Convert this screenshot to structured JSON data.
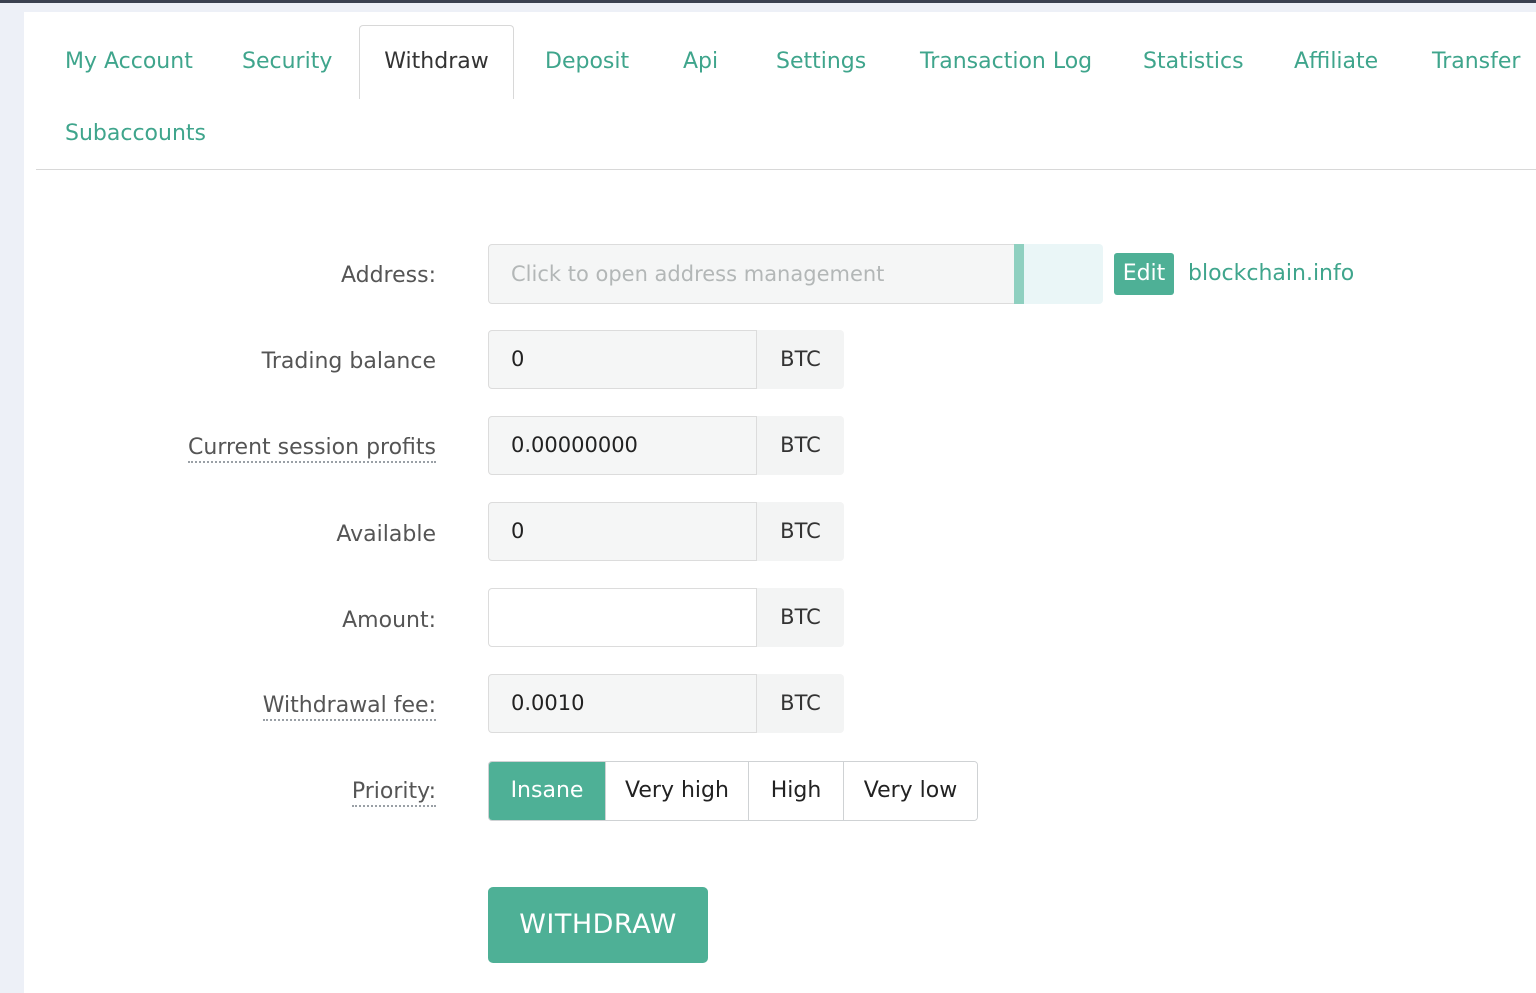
{
  "tabs": {
    "row1": [
      "My Account",
      "Security",
      "Withdraw",
      "Deposit",
      "Api",
      "Settings",
      "Transaction Log",
      "Statistics",
      "Affiliate",
      "Transfer"
    ],
    "row2": [
      "Subaccounts"
    ],
    "active": "Withdraw"
  },
  "form": {
    "address_label": "Address:",
    "address_placeholder": "Click to open address management",
    "edit_label": "Edit",
    "explorer_link": "blockchain.info",
    "trading_balance_label": "Trading balance",
    "trading_balance_value": "0",
    "session_profits_label": "Current session profits",
    "session_profits_value": "0.00000000",
    "available_label": "Available",
    "available_value": "0",
    "amount_label": "Amount:",
    "amount_value": "",
    "fee_label": "Withdrawal fee:",
    "fee_value": "0.0010",
    "currency": "BTC",
    "priority_label": "Priority:",
    "priority_options": [
      "Insane",
      "Very high",
      "High",
      "Very low"
    ],
    "priority_selected": "Insane",
    "withdraw_button": "WITHDRAW"
  },
  "colors": {
    "accent": "#4eb096",
    "link": "#3fa58c",
    "background": "#edf0f7"
  }
}
